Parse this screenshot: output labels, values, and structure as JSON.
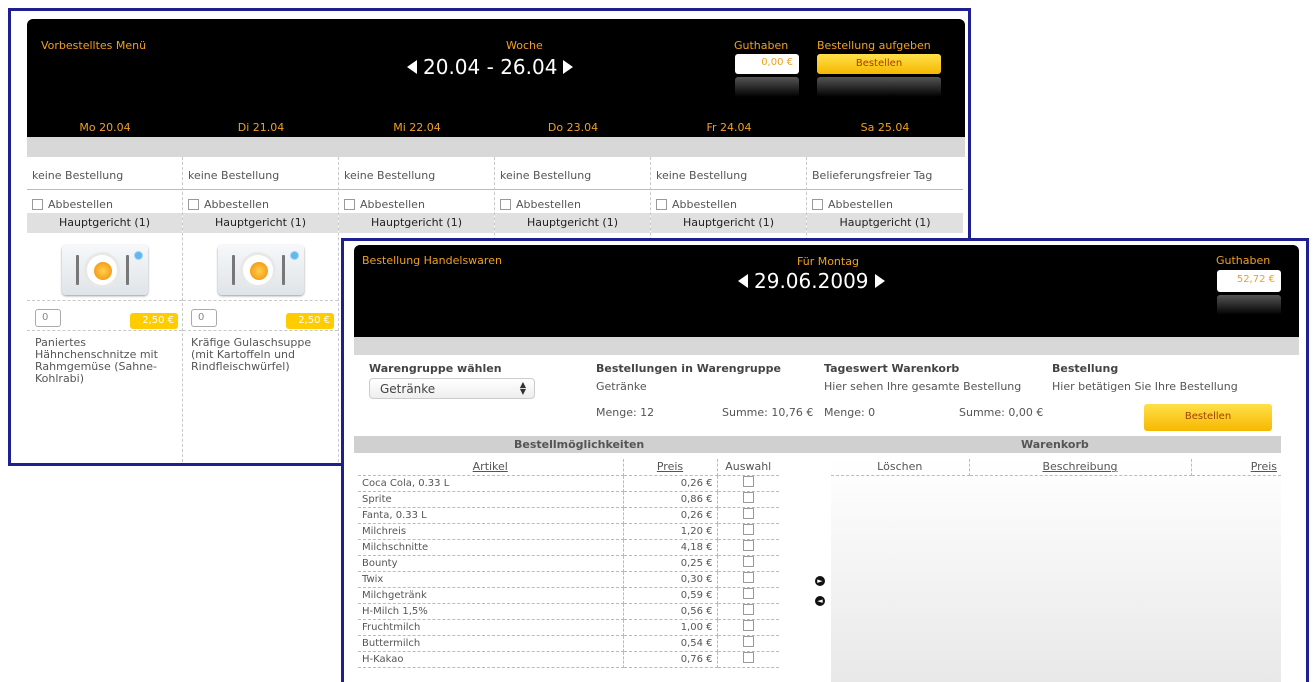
{
  "weekly": {
    "menu_title": "Vorbestelltes Menü",
    "week_label": "Woche",
    "week_range": "20.04 - 26.04",
    "balance_label": "Guthaben",
    "balance_value": "0,00 €",
    "order_label": "Bestellung aufgeben",
    "order_button": "Bestellen",
    "days": [
      {
        "day": "Mo 20.04",
        "status": "keine Bestellung",
        "cancel": "Abbestellen",
        "category": "Hauptgericht (1)",
        "qty": "0",
        "price": "2,50 €",
        "desc": "Paniertes Hähnchenschnitze mit Rahmgemüse (Sahne-Kohlrabi)"
      },
      {
        "day": "Di 21.04",
        "status": "keine Bestellung",
        "cancel": "Abbestellen",
        "category": "Hauptgericht (1)",
        "qty": "0",
        "price": "2,50 €",
        "desc": "Kräfige Gulaschsuppe (mit Kartoffeln und Rindfleischwürfel)"
      },
      {
        "day": "Mi 22.04",
        "status": "keine Bestellung",
        "cancel": "Abbestellen",
        "category": "Hauptgericht (1)"
      },
      {
        "day": "Do 23.04",
        "status": "keine Bestellung",
        "cancel": "Abbestellen",
        "category": "Hauptgericht (1)"
      },
      {
        "day": "Fr 24.04",
        "status": "keine Bestellung",
        "cancel": "Abbestellen",
        "category": "Hauptgericht (1)"
      },
      {
        "day": "Sa 25.04",
        "status": "Belieferungsfreier Tag",
        "cancel": "Abbestellen",
        "category": "Hauptgericht (1)"
      }
    ]
  },
  "goods": {
    "title": "Bestellung Handelswaren",
    "for_label": "Für Montag",
    "date": "29.06.2009",
    "balance_label": "Guthaben",
    "balance_value": "52,72 €",
    "group_heading": "Warengruppe wählen",
    "group_selected": "Getränke",
    "orders_heading": "Bestellungen in Warengruppe",
    "orders_group": "Getränke",
    "orders_qty": "Menge: 12",
    "orders_sum": "Summe: 10,76 €",
    "cart_heading": "Tageswert Warenkorb",
    "cart_text": "Hier sehen Ihre gesamte Bestellung",
    "cart_qty": "Menge: 0",
    "cart_sum": "Summe: 0,00 €",
    "order_heading": "Bestellung",
    "order_text": "Hier betätigen Sie Ihre Bestellung",
    "order_button": "Bestellen",
    "options_heading": "Bestellmöglichkeiten",
    "basket_heading": "Warenkorb",
    "col_article": "Artikel",
    "col_price": "Preis",
    "col_select": "Auswahl",
    "col_delete": "Löschen",
    "col_description": "Beschreibung",
    "col_price2": "Preis",
    "articles": [
      {
        "name": "Coca Cola, 0.33 L",
        "price": "0,26 €"
      },
      {
        "name": "Sprite",
        "price": "0,86 €"
      },
      {
        "name": "Fanta, 0.33 L",
        "price": "0,26 €"
      },
      {
        "name": "Milchreis",
        "price": "1,20 €"
      },
      {
        "name": "Milchschnitte",
        "price": "4,18 €"
      },
      {
        "name": "Bounty",
        "price": "0,25 €"
      },
      {
        "name": "Twix",
        "price": "0,30 €"
      },
      {
        "name": "Milchgetränk",
        "price": "0,59 €"
      },
      {
        "name": "H-Milch 1,5%",
        "price": "0,56 €"
      },
      {
        "name": "Fruchtmilch",
        "price": "1,00 €"
      },
      {
        "name": "Buttermilch",
        "price": "0,54 €"
      },
      {
        "name": "H-Kakao",
        "price": "0,76 €"
      }
    ]
  }
}
